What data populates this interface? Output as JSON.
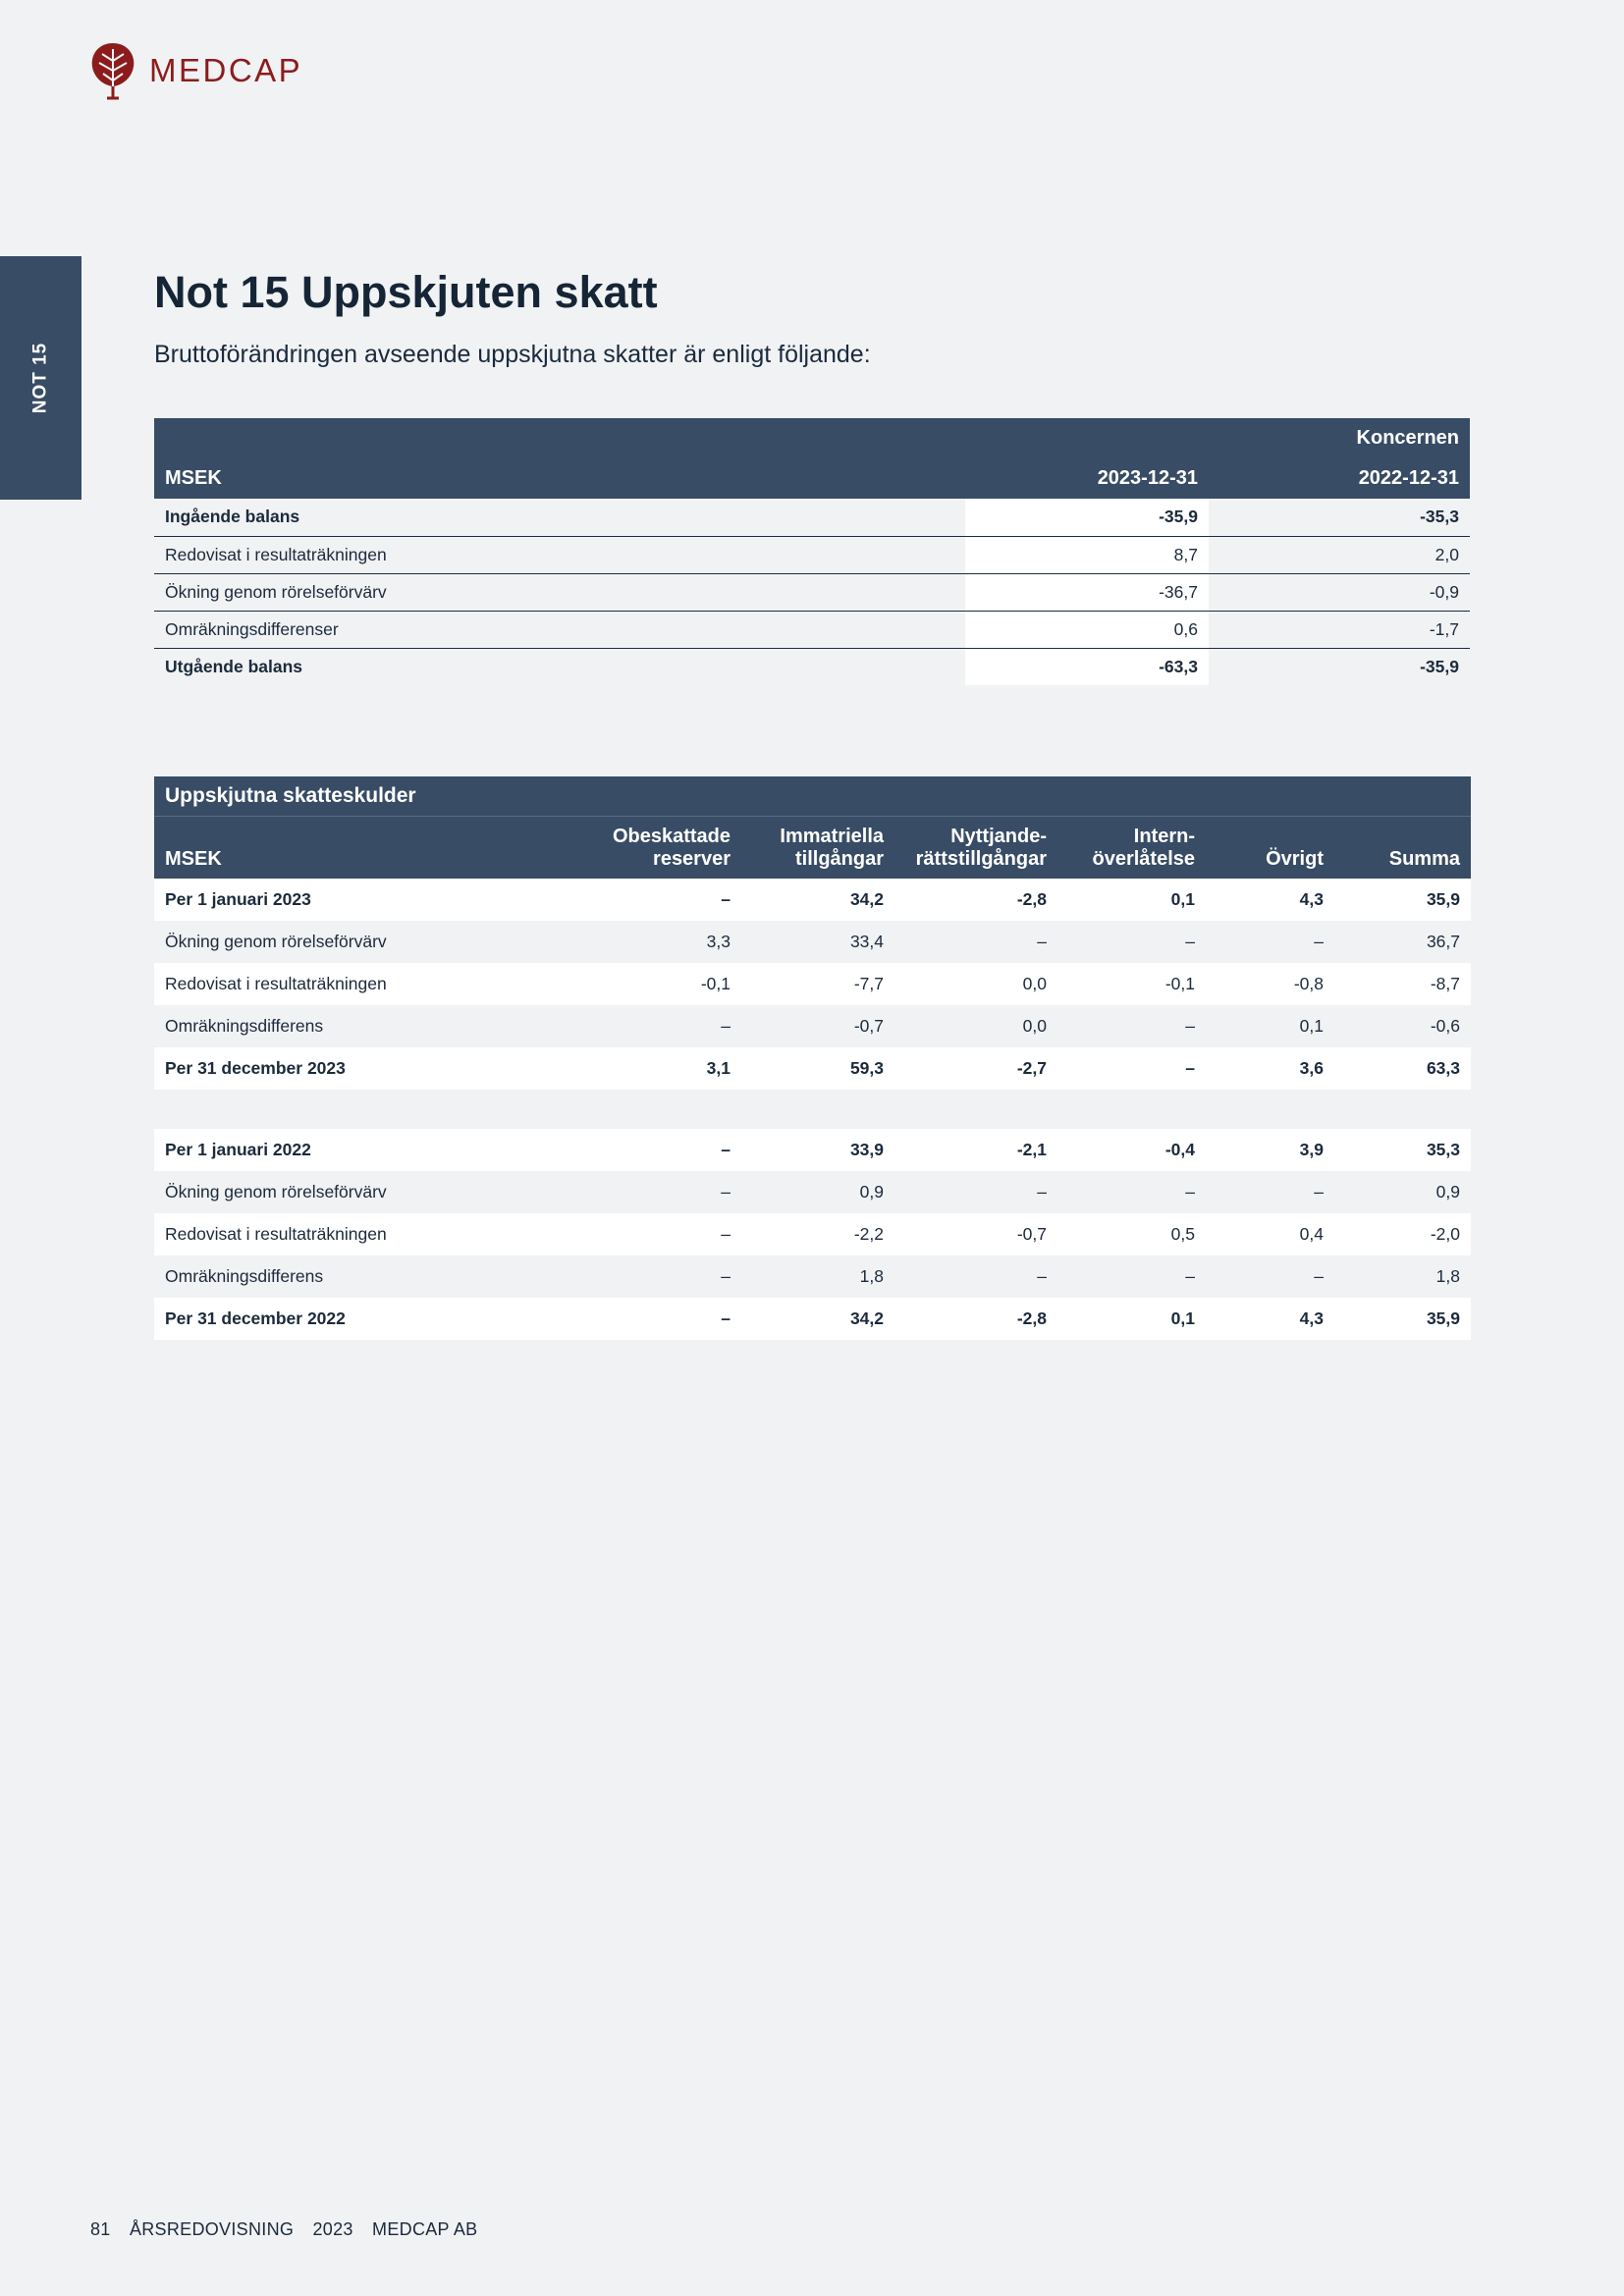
{
  "logo": {
    "text": "MEDCAP",
    "color": "#8c1c1c"
  },
  "side_tab": "NOT 15",
  "title": "Not 15 Uppskjuten skatt",
  "intro": "Bruttoförändringen avseende uppskjutna skatter är enligt följande:",
  "table1": {
    "group_label": "Koncernen",
    "headers": [
      "MSEK",
      "2023-12-31",
      "2022-12-31"
    ],
    "rows": [
      [
        "Ingående balans",
        "-35,9",
        "-35,3"
      ],
      [
        "Redovisat i resultaträkningen",
        "8,7",
        "2,0"
      ],
      [
        "Ökning genom rörelseförvärv",
        "-36,7",
        "-0,9"
      ],
      [
        "Omräkningsdifferenser",
        "0,6",
        "-1,7"
      ],
      [
        "Utgående balans",
        "-63,3",
        "-35,9"
      ]
    ]
  },
  "table2": {
    "caption": "Uppskjutna skatteskulder",
    "headers": [
      "MSEK",
      "Obeskattade reserver",
      "Immatriella tillgångar",
      "Nyttjande-rättstillgångar",
      "Intern-överlåtelse",
      "Övrigt",
      "Summa"
    ],
    "header_lines": [
      [
        "",
        ""
      ],
      [
        "Obeskattade",
        "reserver"
      ],
      [
        "Immatriella",
        "tillgångar"
      ],
      [
        "Nyttjande-",
        "rättstillgångar"
      ],
      [
        "Intern-",
        "överlåtelse"
      ],
      [
        "",
        "Övrigt"
      ],
      [
        "",
        "Summa"
      ]
    ],
    "rows": [
      [
        "Per 1 januari 2023",
        "–",
        "34,2",
        "-2,8",
        "0,1",
        "4,3",
        "35,9"
      ],
      [
        "Ökning genom rörelseförvärv",
        "3,3",
        "33,4",
        "–",
        "–",
        "–",
        "36,7"
      ],
      [
        "Redovisat i resultaträkningen",
        "-0,1",
        "-7,7",
        "0,0",
        "-0,1",
        "-0,8",
        "-8,7"
      ],
      [
        "Omräkningsdifferens",
        "–",
        "-0,7",
        "0,0",
        "–",
        "0,1",
        "-0,6"
      ],
      [
        "Per 31 december 2023",
        "3,1",
        "59,3",
        "-2,7",
        "–",
        "3,6",
        "63,3"
      ],
      [
        "Per 1 januari 2022",
        "–",
        "33,9",
        "-2,1",
        "-0,4",
        "3,9",
        "35,3"
      ],
      [
        "Ökning genom rörelseförvärv",
        "–",
        "0,9",
        "–",
        "–",
        "–",
        "0,9"
      ],
      [
        "Redovisat i resultaträkningen",
        "–",
        "-2,2",
        "-0,7",
        "0,5",
        "0,4",
        "-2,0"
      ],
      [
        "Omräkningsdifferens",
        "–",
        "1,8",
        "–",
        "–",
        "–",
        "1,8"
      ],
      [
        "Per 31 december 2022",
        "–",
        "34,2",
        "-2,8",
        "0,1",
        "4,3",
        "35,9"
      ]
    ]
  },
  "footer": {
    "page": "81",
    "doc": "ÅRSREDOVISNING",
    "year": "2023",
    "company": "MEDCAP AB"
  },
  "colors": {
    "header_bg": "#384c65",
    "page_bg": "#f0f2f4",
    "text": "#16273a"
  }
}
